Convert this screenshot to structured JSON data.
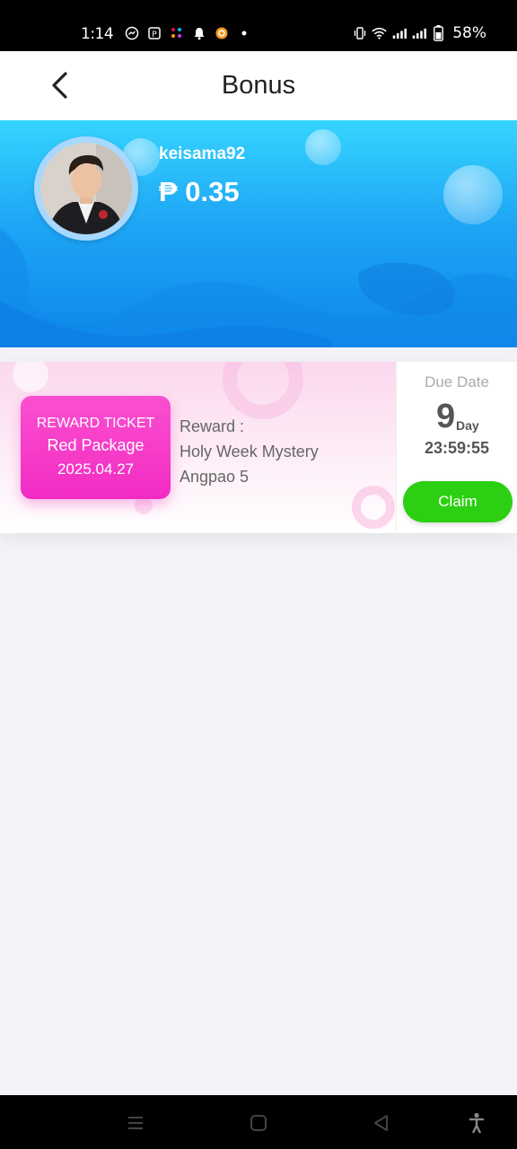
{
  "status_bar": {
    "time": "1:14",
    "battery": "58%"
  },
  "header": {
    "title": "Bonus",
    "back_icon": "chevron-left-icon"
  },
  "profile": {
    "username": "keisama92",
    "balance": "₱ 0.35"
  },
  "reward_card": {
    "ticket": {
      "label": "REWARD TICKET",
      "name": "Red Package",
      "date": "2025.04.27"
    },
    "reward_label": "Reward :",
    "reward_line1": "Holy Week Mystery",
    "reward_line2": "Angpao 5",
    "due_label": "Due Date",
    "due_days": "9",
    "due_unit": "Day",
    "due_time": "23:59:55",
    "claim_label": "Claim"
  },
  "colors": {
    "banner_top": "#36d4ff",
    "banner_bottom": "#0c86ea",
    "ticket": "#f12bc3",
    "claim": "#2dcf12"
  },
  "nav_bar": {
    "icons": [
      "recents-icon",
      "home-icon",
      "back-icon",
      "accessibility-icon"
    ]
  }
}
